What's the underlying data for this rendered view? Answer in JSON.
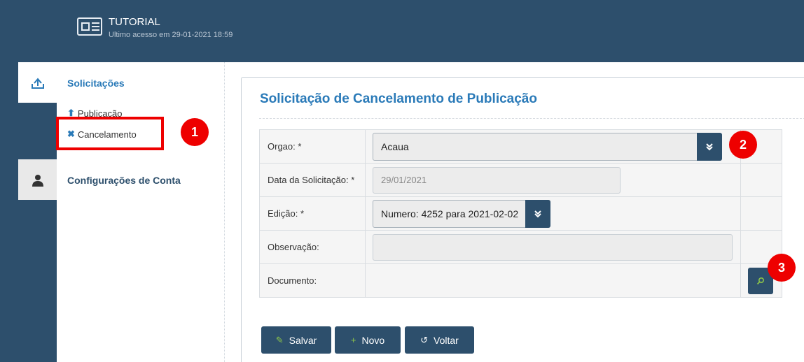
{
  "header": {
    "title": "TUTORIAL",
    "subtitle": "Ultimo acesso em 29-01-2021 18:59"
  },
  "sidebar": {
    "tabs": [
      {
        "icon": "upload-tray-icon",
        "active": true
      },
      {
        "icon": "user-icon",
        "active": false
      }
    ],
    "sections": [
      {
        "label": "Solicitações",
        "items": [
          {
            "label": "Publicação",
            "icon": "upload-icon"
          },
          {
            "label": "Cancelamento",
            "icon": "x-icon"
          }
        ]
      },
      {
        "label": "Configurações de Conta",
        "items": []
      }
    ]
  },
  "form": {
    "title": "Solicitação de Cancelamento de Publicação",
    "fields": [
      {
        "label": "Orgao: *",
        "value": "Acaua"
      },
      {
        "label": "Data da Solicitação: *",
        "value": "29/01/2021"
      },
      {
        "label": "Edição: *",
        "value": "Numero: 4252 para 2021-02-02"
      },
      {
        "label": "Observação:",
        "value": ""
      },
      {
        "label": "Documento:",
        "value": ""
      }
    ]
  },
  "buttons": {
    "save": "Salvar",
    "new": "Novo",
    "back": "Voltar"
  },
  "annotations": {
    "one": "1",
    "two": "2",
    "three": "3",
    "color": "#ee0000"
  },
  "colors": {
    "header_bg": "#2d4f6c",
    "accent_blue": "#2a7ab8",
    "button_bg": "#2d4f6c",
    "icon_green": "#8bc34a"
  }
}
